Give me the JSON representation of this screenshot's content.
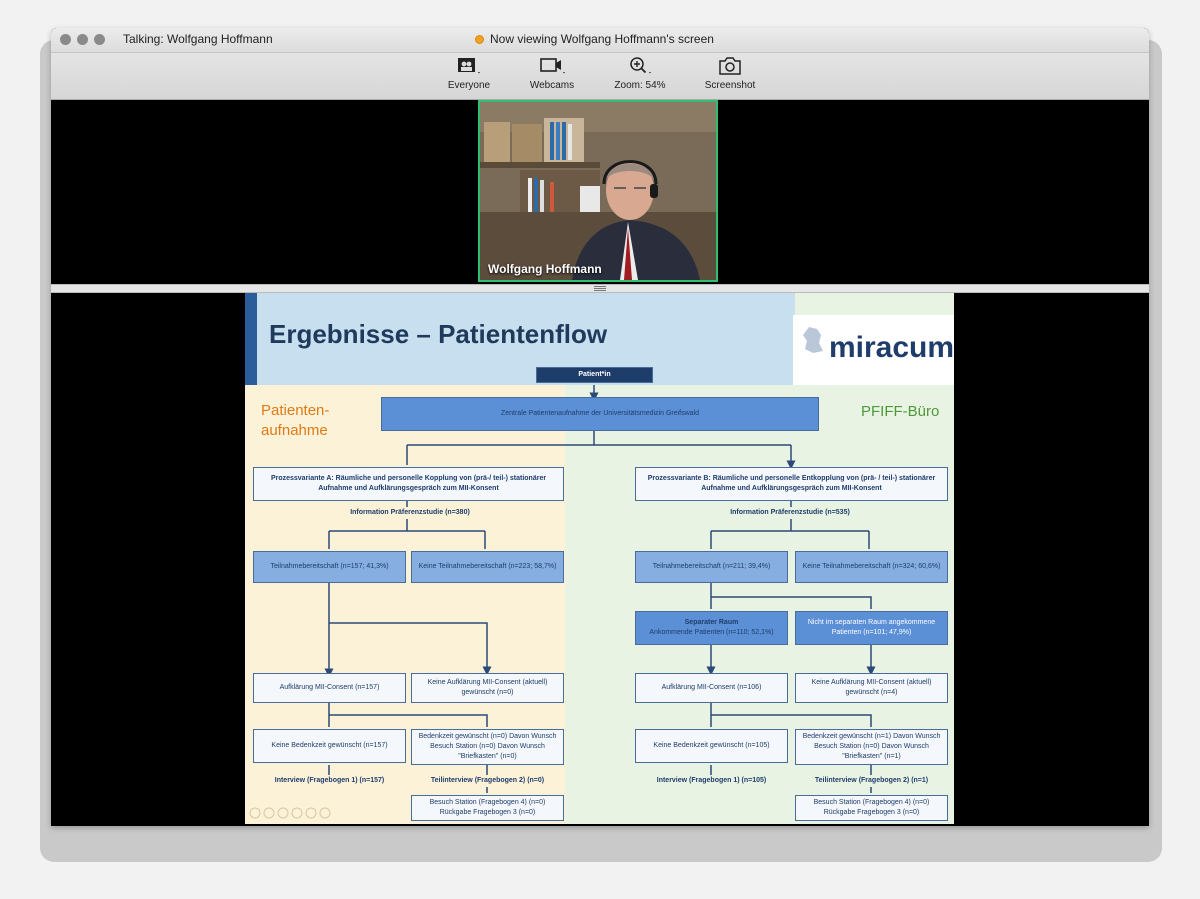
{
  "window": {
    "talking_label": "Talking: Wolfgang Hoffmann",
    "viewing_label": "Now viewing Wolfgang Hoffmann's screen"
  },
  "toolbar": {
    "everyone": "Everyone",
    "webcams": "Webcams",
    "zoom": "Zoom: 54%",
    "screenshot": "Screenshot"
  },
  "video": {
    "name": "Wolfgang Hoffmann"
  },
  "slide": {
    "title": "Ergebnisse – Patientenflow",
    "logo": "miracum",
    "left_side_label_1": "Patienten-",
    "left_side_label_2": "aufnahme",
    "right_side_label": "PFIFF-Büro",
    "top_box": "Patient*in",
    "central_box": "Zentrale Patientenaufnahme der Universitätsmedizin Greifswald",
    "variant_a": "Prozessvariante A: Räumliche und personelle Kopplung von (prä-/ teil-) stationärer Aufnahme und Aufklärungsgespräch zum MII-Konsent",
    "variant_b": "Prozessvariante B: Räumliche und personelle Entkopplung von (prä- / teil-) stationärer Aufnahme und Aufklärungsgespräch zum MII-Konsent",
    "info_a": "Information Präferenzstudie (n=380)",
    "info_b": "Information Präferenzstudie (n=535)",
    "a_yes": "Teilnahmebereitschaft (n=157; 41,3%)",
    "a_no": "Keine Teilnahmebereitschaft (n=223; 58,7%)",
    "b_yes": "Teilnahmebereitschaft (n=211; 39,4%)",
    "b_no": "Keine Teilnahmebereitschaft (n=324; 60,6%)",
    "b_sep_title": "Separater Raum",
    "b_sep": "Ankommende Patienten (n=110; 52,1%)",
    "b_notsep": "Nicht im separaten Raum angekommene Patienten (n=101; 47,9%)",
    "a_consent": "Aufklärung MII-Consent (n=157)",
    "a_noconsent": "Keine Aufklärung MII-Consent (aktuell) gewünscht (n=0)",
    "b_consent": "Aufklärung MII-Consent (n=106)",
    "b_noconsent": "Keine Aufklärung MII-Consent (aktuell) gewünscht (n=4)",
    "a_nothink": "Keine Bedenkzeit gewünscht (n=157)",
    "a_think": "Bedenkzeit gewünscht (n=0) Davon Wunsch Besuch Station (n=0) Davon Wunsch \"Briefkasten\" (n=0)",
    "b_nothink": "Keine Bedenkzeit gewünscht (n=105)",
    "b_think": "Bedenkzeit gewünscht (n=1) Davon Wunsch Besuch Station (n=0) Davon Wunsch \"Briefkasten\" (n=1)",
    "a_interview": "Interview (Fragebogen 1) (n=157)",
    "a_partial": "Teilinterview (Fragebogen 2) (n=0)",
    "b_interview": "Interview (Fragebogen 1) (n=105)",
    "b_partial": "Teilinterview (Fragebogen 2) (n=1)",
    "a_visit": "Besuch Station (Fragebogen 4) (n=0) Rückgabe Fragebogen 3 (n=0)",
    "b_visit": "Besuch Station (Fragebogen 4) (n=0) Rückgabe Fragebogen 3 (n=0)"
  }
}
